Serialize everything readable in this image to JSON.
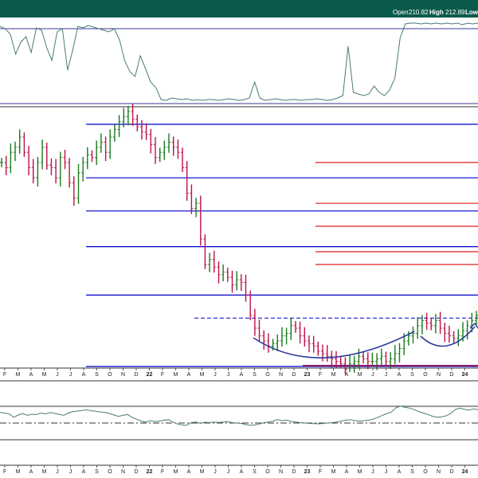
{
  "header": {
    "open_label": "Open",
    "open_value": "210.82",
    "high_label": "High",
    "high_value": "212.89",
    "low_label": "Low",
    "bar_color": "#0b5b4c"
  },
  "chart_data": [
    {
      "type": "line",
      "panel": "upper-indicator",
      "series": [
        {
          "values": [
            0.95,
            0.92,
            0.85,
            0.6,
            0.75,
            0.82,
            0.62,
            0.93,
            0.9,
            0.68,
            0.52,
            0.88,
            0.92,
            0.4,
            0.65,
            0.95,
            0.93,
            0.96,
            0.94,
            0.92,
            0.9,
            0.88,
            0.92,
            0.78,
            0.52,
            0.38,
            0.32,
            0.58,
            0.42,
            0.25,
            0.18,
            0.03,
            0.02,
            0.05,
            0.04,
            0.03,
            0.04,
            0.02,
            0.03,
            0.02,
            0.03,
            0.03,
            0.02,
            0.03,
            0.04,
            0.03,
            0.02,
            0.03,
            0.05,
            0.25,
            0.05,
            0.02,
            0.03,
            0.04,
            0.03,
            0.02,
            0.03,
            0.03,
            0.02,
            0.03,
            0.03,
            0.04,
            0.03,
            0.02,
            0.03,
            0.05,
            0.08,
            0.7,
            0.12,
            0.1,
            0.08,
            0.1,
            0.2,
            0.12,
            0.08,
            0.15,
            0.3,
            0.8,
            0.98,
            0.99,
            0.99,
            0.98,
            0.99,
            0.98,
            0.99,
            0.98,
            0.99,
            0.98,
            0.99,
            0.97,
            0.99,
            0.98,
            0.99
          ],
          "color": "#4a7a7a"
        }
      ]
    },
    {
      "type": "ohlc",
      "panel": "price",
      "horizontal_levels_blue_solid": [
        0.0,
        0.28,
        0.47,
        0.61,
        0.74,
        0.95
      ],
      "horizontal_levels_red": [
        0.4,
        0.45,
        0.55,
        0.64,
        0.8
      ],
      "resistance_dashed_level": 0.19,
      "series": [
        {
          "name": "",
          "closes": [
            0.8,
            0.78,
            0.84,
            0.86,
            0.9,
            0.84,
            0.78,
            0.74,
            0.8,
            0.86,
            0.79,
            0.78,
            0.74,
            0.82,
            0.8,
            0.72,
            0.66,
            0.76,
            0.8,
            0.83,
            0.82,
            0.86,
            0.88,
            0.84,
            0.9,
            0.93,
            0.96,
            0.98,
            1.0,
            0.97,
            0.94,
            0.92,
            0.91,
            0.87,
            0.82,
            0.84,
            0.86,
            0.88,
            0.86,
            0.84,
            0.78,
            0.68,
            0.62,
            0.64,
            0.5,
            0.4,
            0.42,
            0.39,
            0.36,
            0.37,
            0.35,
            0.32,
            0.34,
            0.33,
            0.28,
            0.2,
            0.15,
            0.12,
            0.1,
            0.08,
            0.09,
            0.1,
            0.12,
            0.13,
            0.16,
            0.15,
            0.12,
            0.1,
            0.09,
            0.08,
            0.06,
            0.05,
            0.04,
            0.03,
            0.02,
            0.01,
            0.0,
            0.01,
            0.02,
            0.04,
            0.03,
            0.02,
            0.02,
            0.03,
            0.04,
            0.02,
            0.03,
            0.05,
            0.07,
            0.1,
            0.12,
            0.13,
            0.16,
            0.18,
            0.17,
            0.16,
            0.18,
            0.15,
            0.13,
            0.12,
            0.11,
            0.12,
            0.14,
            0.16,
            0.18,
            0.2
          ]
        }
      ]
    },
    {
      "type": "line",
      "panel": "lower-indicator",
      "series": [
        {
          "values": [
            0.55,
            0.52,
            0.48,
            0.3,
            0.42,
            0.5,
            0.4,
            0.46,
            0.44,
            0.52,
            0.48,
            0.55,
            0.5,
            0.46,
            0.4,
            0.52,
            0.6,
            0.62,
            0.66,
            0.7,
            0.64,
            0.62,
            0.58,
            0.56,
            0.5,
            0.42,
            0.35,
            0.4,
            0.45,
            0.3,
            0.2,
            0.1,
            0.05,
            0.12,
            0.08,
            0.1,
            0.15,
            0.18,
            0.05,
            -0.05,
            -0.1,
            -0.12,
            0.02,
            0.05,
            -0.02,
            0.04,
            0.02,
            0.05,
            0.03,
            0.05,
            0.08,
            0.02,
            0.0,
            -0.02,
            -0.08,
            -0.12,
            -0.1,
            -0.05,
            0.02,
            0.05,
            0.1,
            0.18,
            0.12,
            0.15,
            0.08,
            0.05,
            0.02,
            0.0,
            -0.02,
            -0.03,
            -0.04,
            -0.02,
            0.0,
            0.02,
            0.05,
            0.1,
            0.15,
            0.18,
            0.12,
            0.1,
            0.12,
            0.15,
            0.2,
            0.3,
            0.4,
            0.5,
            0.58,
            0.8,
            0.88,
            0.82,
            0.78,
            0.7,
            0.6,
            0.52,
            0.45,
            0.35,
            0.3,
            0.32,
            0.38,
            0.5,
            0.7,
            0.78,
            0.72,
            0.68,
            0.74,
            0.7
          ],
          "color": "#4a7a7a"
        }
      ]
    }
  ],
  "x_axis": {
    "labels": [
      "F",
      "M",
      "A",
      "M",
      "J",
      "J",
      "A",
      "S",
      "O",
      "N",
      "D",
      "22",
      "F",
      "M",
      "A",
      "M",
      "J",
      "J",
      "A",
      "S",
      "O",
      "N",
      "D",
      "23",
      "F",
      "M",
      "A",
      "M",
      "J",
      "J",
      "A",
      "S",
      "O",
      "N",
      "D",
      "24"
    ],
    "bold": [
      "22",
      "23",
      "24"
    ]
  },
  "colors": {
    "up": "#1a7a1a",
    "down": "#c0104a",
    "blue_line": "#0000cc",
    "red_line": "#dd2222",
    "indicator_line": "#4a7a7a",
    "fill_orange": "#e8a033",
    "fill_teal": "#1a7060",
    "cup_arc": "#2a3a9a"
  }
}
